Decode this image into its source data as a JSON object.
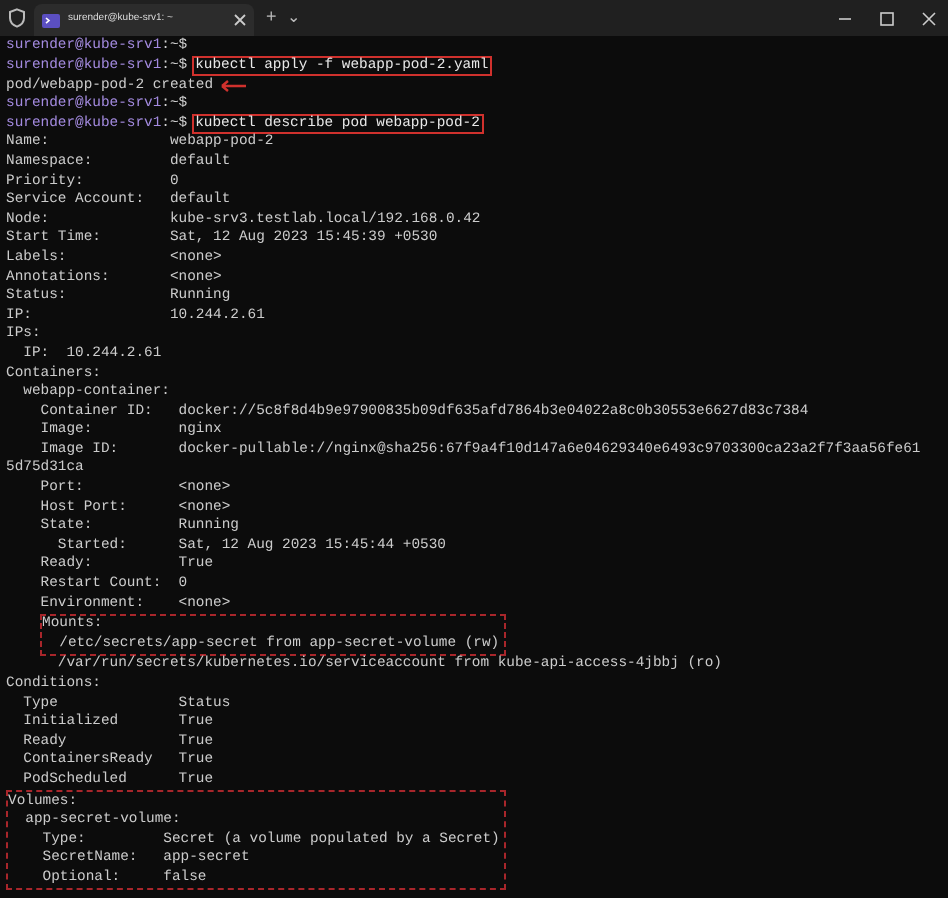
{
  "window": {
    "tab_title": "surender@kube-srv1: ~",
    "new_tab": "+",
    "dropdown": "⌄"
  },
  "blocks": [
    {
      "boxed": false,
      "lines": [
        {
          "kind": "prompt",
          "user_host": "surender@kube-srv1",
          "path": ":~$"
        },
        {
          "kind": "prompt",
          "user_host": "surender@kube-srv1",
          "path": ":~$",
          "command": "kubectl apply -f webapp-pod-2.yaml",
          "highlighted": true
        },
        {
          "kind": "output",
          "text": "pod/webapp-pod-2 created",
          "arrow": true
        },
        {
          "kind": "prompt",
          "user_host": "surender@kube-srv1",
          "path": ":~$"
        },
        {
          "kind": "prompt",
          "user_host": "surender@kube-srv1",
          "path": ":~$",
          "command": "kubectl describe pod webapp-pod-2",
          "highlighted": true
        },
        {
          "kind": "output",
          "text": "Name:              webapp-pod-2",
          "arrow": false
        },
        {
          "kind": "output",
          "text": "Namespace:         default",
          "arrow": false
        },
        {
          "kind": "output",
          "text": "Priority:          0",
          "arrow": false
        },
        {
          "kind": "output",
          "text": "Service Account:   default",
          "arrow": false
        },
        {
          "kind": "output",
          "text": "Node:              kube-srv3.testlab.local/192.168.0.42",
          "arrow": false
        },
        {
          "kind": "output",
          "text": "Start Time:        Sat, 12 Aug 2023 15:45:39 +0530",
          "arrow": false
        },
        {
          "kind": "output",
          "text": "Labels:            <none>",
          "arrow": false
        },
        {
          "kind": "output",
          "text": "Annotations:       <none>",
          "arrow": false
        },
        {
          "kind": "output",
          "text": "Status:            Running",
          "arrow": false
        },
        {
          "kind": "output",
          "text": "IP:                10.244.2.61",
          "arrow": false
        },
        {
          "kind": "output",
          "text": "IPs:",
          "arrow": false
        },
        {
          "kind": "output",
          "text": "  IP:  10.244.2.61",
          "arrow": false
        },
        {
          "kind": "output",
          "text": "Containers:",
          "arrow": false
        },
        {
          "kind": "output",
          "text": "  webapp-container:",
          "arrow": false
        },
        {
          "kind": "output",
          "text": "    Container ID:   docker://5c8f8d4b9e97900835b09df635afd7864b3e04022a8c0b30553e6627d83c7384",
          "arrow": false
        },
        {
          "kind": "output",
          "text": "    Image:          nginx",
          "arrow": false
        },
        {
          "kind": "output",
          "text": "    Image ID:       docker-pullable://nginx@sha256:67f9a4f10d147a6e04629340e6493c9703300ca23a2f7f3aa56fe61",
          "arrow": false
        },
        {
          "kind": "output",
          "text": "5d75d31ca",
          "arrow": false
        },
        {
          "kind": "output",
          "text": "    Port:           <none>",
          "arrow": false
        },
        {
          "kind": "output",
          "text": "    Host Port:      <none>",
          "arrow": false
        },
        {
          "kind": "output",
          "text": "    State:          Running",
          "arrow": false
        },
        {
          "kind": "output",
          "text": "      Started:      Sat, 12 Aug 2023 15:45:44 +0530",
          "arrow": false
        },
        {
          "kind": "output",
          "text": "    Ready:          True",
          "arrow": false
        },
        {
          "kind": "output",
          "text": "    Restart Count:  0",
          "arrow": false
        },
        {
          "kind": "output",
          "text": "    Environment:    <none>",
          "arrow": false
        }
      ]
    },
    {
      "boxed": true,
      "indented": true,
      "lines": [
        {
          "kind": "output",
          "text": "Mounts:",
          "arrow": false
        },
        {
          "kind": "output",
          "text": "  /etc/secrets/app-secret from app-secret-volume (rw)",
          "arrow": false
        }
      ]
    },
    {
      "boxed": false,
      "lines": [
        {
          "kind": "output",
          "text": "      /var/run/secrets/kubernetes.io/serviceaccount from kube-api-access-4jbbj (ro)",
          "arrow": false
        },
        {
          "kind": "output",
          "text": "Conditions:",
          "arrow": false
        },
        {
          "kind": "output",
          "text": "  Type              Status",
          "arrow": false
        },
        {
          "kind": "output",
          "text": "  Initialized       True",
          "arrow": false
        },
        {
          "kind": "output",
          "text": "  Ready             True",
          "arrow": false
        },
        {
          "kind": "output",
          "text": "  ContainersReady   True",
          "arrow": false
        },
        {
          "kind": "output",
          "text": "  PodScheduled      True",
          "arrow": false
        }
      ]
    },
    {
      "boxed": true,
      "lines": [
        {
          "kind": "output",
          "text": "Volumes:",
          "arrow": false
        },
        {
          "kind": "output",
          "text": "  app-secret-volume:",
          "arrow": false
        },
        {
          "kind": "output",
          "text": "    Type:         Secret (a volume populated by a Secret)",
          "arrow": false
        },
        {
          "kind": "output",
          "text": "    SecretName:   app-secret",
          "arrow": false
        },
        {
          "kind": "output",
          "text": "    Optional:     false",
          "arrow": false
        }
      ]
    }
  ]
}
